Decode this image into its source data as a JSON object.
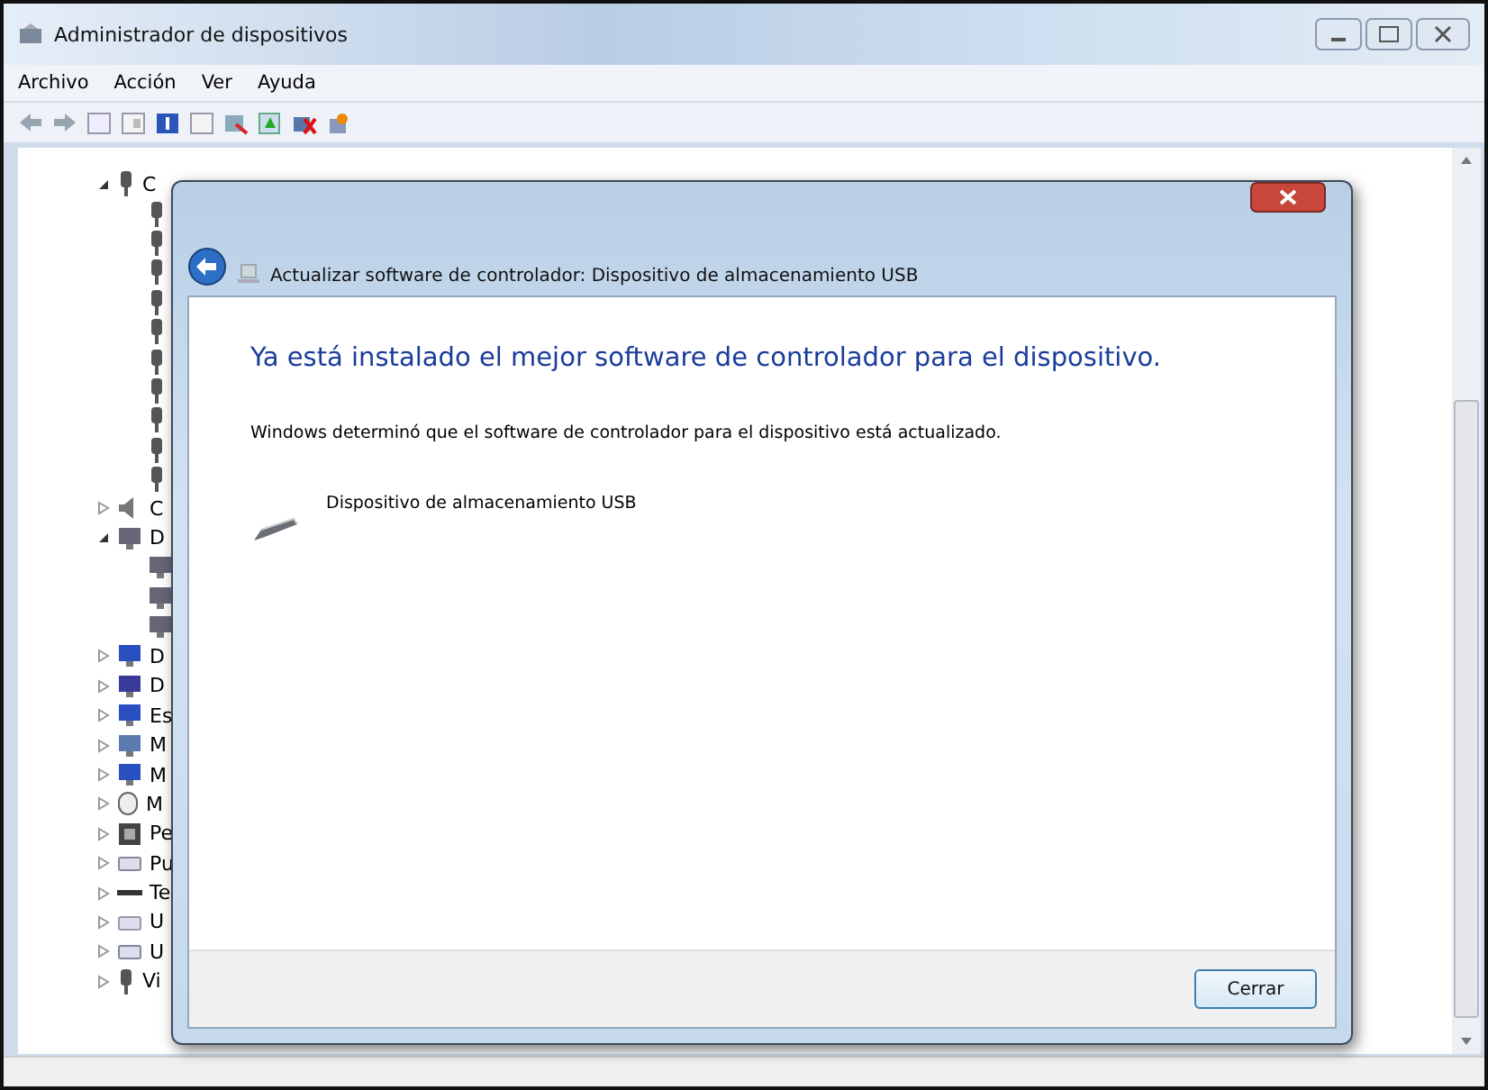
{
  "window": {
    "title": "Administrador de dispositivos"
  },
  "menu": [
    "Archivo",
    "Acción",
    "Ver",
    "Ayuda"
  ],
  "tree": [
    {
      "label": "C",
      "kind": "usb",
      "expanded": true,
      "children": [
        {
          "kind": "usb"
        },
        {
          "kind": "usb"
        },
        {
          "kind": "usb"
        },
        {
          "kind": "usb"
        },
        {
          "kind": "usb"
        },
        {
          "kind": "usb"
        },
        {
          "kind": "usb"
        },
        {
          "kind": "usb"
        },
        {
          "kind": "usb"
        },
        {
          "kind": "usb"
        }
      ]
    },
    {
      "label": "C",
      "kind": "audio",
      "expanded": false
    },
    {
      "label": "D",
      "kind": "disk",
      "expanded": true,
      "children": [
        {
          "kind": "disk"
        },
        {
          "kind": "disk"
        },
        {
          "kind": "disk"
        }
      ]
    },
    {
      "label": "D",
      "kind": "monitor",
      "expanded": false
    },
    {
      "label": "D",
      "kind": "display",
      "expanded": false
    },
    {
      "label": "Es",
      "kind": "monitor",
      "expanded": false
    },
    {
      "label": "M",
      "kind": "screen",
      "expanded": false
    },
    {
      "label": "M",
      "kind": "monitor",
      "expanded": false
    },
    {
      "label": "M",
      "kind": "mouse",
      "expanded": false
    },
    {
      "label": "Pe",
      "kind": "chip",
      "expanded": false
    },
    {
      "label": "Pu",
      "kind": "port",
      "expanded": false
    },
    {
      "label": "Te",
      "kind": "keyboard",
      "expanded": false
    },
    {
      "label": "U",
      "kind": "drive",
      "expanded": false
    },
    {
      "label": "U",
      "kind": "network",
      "expanded": false
    },
    {
      "label": "Vi",
      "kind": "usb",
      "expanded": false
    }
  ],
  "dialog": {
    "header": "Actualizar software de controlador: Dispositivo de almacenamiento USB",
    "heading": "Ya está instalado el mejor software de controlador para el dispositivo.",
    "message": "Windows determinó que el software de controlador para el dispositivo está actualizado.",
    "device": "Dispositivo de almacenamiento USB",
    "buttons": [
      "Cerrar"
    ]
  }
}
